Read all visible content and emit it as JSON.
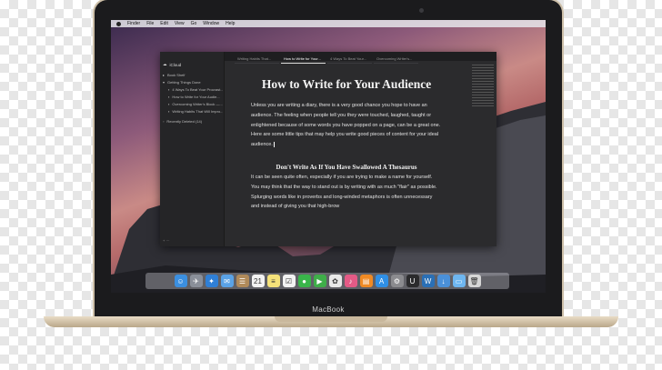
{
  "device": {
    "brand_label": "MacBook"
  },
  "menubar": {
    "items": [
      "Finder",
      "File",
      "Edit",
      "View",
      "Go",
      "Window",
      "Help"
    ]
  },
  "sidebar": {
    "header": "iCloud",
    "items": [
      {
        "label": "Book Shelf",
        "icon": "folder-icon",
        "level": 0
      },
      {
        "label": "Getting Things Done",
        "icon": "folder-icon",
        "level": 0
      },
      {
        "label": "4 Ways To Beat Your Procrast...",
        "icon": "doc-icon",
        "level": 1
      },
      {
        "label": "How to Write for Your Audie...",
        "icon": "doc-icon",
        "level": 1
      },
      {
        "label": "Overcoming Writer's Block —...",
        "icon": "doc-icon",
        "level": 1
      },
      {
        "label": "Writing Habits That Will Impro...",
        "icon": "doc-icon",
        "level": 1
      },
      {
        "label": "Recently Deleted (14)",
        "icon": "trash-icon",
        "level": 0
      }
    ]
  },
  "tabs": [
    {
      "label": "Writing Habits That...",
      "active": false
    },
    {
      "label": "How to Write for Your...",
      "active": true
    },
    {
      "label": "4 Ways To Beat Your...",
      "active": false
    },
    {
      "label": "Overcoming Writer's...",
      "active": false
    }
  ],
  "document": {
    "title": "How to Write for Your Audience",
    "paragraph1": "Unless you are writing a diary, there is a very good chance you hope to have an audience. The feeling when people tell you they were touched, laughed, taught or enlightened because of some words you have popped on a page, can be a great one.",
    "paragraph2": "Here are some little tips that may help you write good pieces of content for your ideal audience.",
    "heading": "Don't Write As If You Have Swallowed A Thesaurus",
    "paragraph3": "It can be seen quite often, especially if you are trying to make a name for yourself. You may think that the way to stand out is by writing with as much \"flair\" as possible. Splurging words like in proverbs and long-winded metaphors is often unnecessary and instead of giving you that high-brow"
  },
  "dock": {
    "icons": [
      {
        "name": "finder-icon",
        "color": "#3b8fe0",
        "glyph": "☺"
      },
      {
        "name": "launchpad-icon",
        "color": "#8a8f99",
        "glyph": "✈"
      },
      {
        "name": "safari-icon",
        "color": "#2f7fd6",
        "glyph": "✦"
      },
      {
        "name": "mail-icon",
        "color": "#5aa2e6",
        "glyph": "✉"
      },
      {
        "name": "contacts-icon",
        "color": "#b08a5a",
        "glyph": "☰"
      },
      {
        "name": "calendar-icon",
        "color": "#f2f2f2",
        "glyph": "21"
      },
      {
        "name": "notes-icon",
        "color": "#f5e27a",
        "glyph": "≡"
      },
      {
        "name": "reminders-icon",
        "color": "#f2f2f2",
        "glyph": "☑"
      },
      {
        "name": "messages-icon",
        "color": "#39b54a",
        "glyph": "●"
      },
      {
        "name": "facetime-icon",
        "color": "#3fae49",
        "glyph": "▶"
      },
      {
        "name": "photos-icon",
        "color": "#e9e9e9",
        "glyph": "✿"
      },
      {
        "name": "itunes-icon",
        "color": "#e45a86",
        "glyph": "♪"
      },
      {
        "name": "ibooks-icon",
        "color": "#f08a24",
        "glyph": "▤"
      },
      {
        "name": "appstore-icon",
        "color": "#2f8fe5",
        "glyph": "A"
      },
      {
        "name": "preferences-icon",
        "color": "#8b8b8f",
        "glyph": "⚙"
      },
      {
        "name": "ulysses-icon",
        "color": "#2b2b2d",
        "glyph": "U"
      },
      {
        "name": "writer-icon",
        "color": "#2a6fb5",
        "glyph": "W"
      },
      {
        "name": "downloads-icon",
        "color": "#4a90d9",
        "glyph": "↓"
      },
      {
        "name": "folder-icon",
        "color": "#6eb6f0",
        "glyph": "▭"
      },
      {
        "name": "trash-icon",
        "color": "#d6d6d6",
        "glyph": "🗑"
      }
    ]
  }
}
